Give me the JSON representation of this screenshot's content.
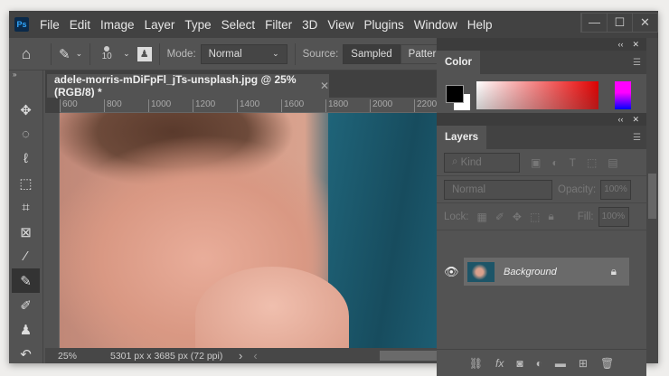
{
  "app": {
    "logo": "Ps",
    "menu": [
      "File",
      "Edit",
      "Image",
      "Layer",
      "Type",
      "Select",
      "Filter",
      "3D",
      "View",
      "Plugins",
      "Window",
      "Help"
    ],
    "window_buttons": [
      "—",
      "☐",
      "✕"
    ]
  },
  "options": {
    "brush_size": "10",
    "mode_label": "Mode:",
    "mode_value": "Normal",
    "source_label": "Source:",
    "source_sampled": "Sampled",
    "source_pattern": "Pattern"
  },
  "document": {
    "tab_title": "adele-morris-mDiFpFl_jTs-unsplash.jpg @ 25% (RGB/8) *",
    "ruler_ticks": [
      "600",
      "800",
      "1000",
      "1200",
      "1400",
      "1600",
      "1800",
      "2000",
      "2200"
    ],
    "zoom": "25%",
    "info": "5301 px x 3685 px (72 ppi)"
  },
  "color_panel": {
    "title": "Color"
  },
  "layers_panel": {
    "title": "Layers",
    "filter": "Kind",
    "blend": "Normal",
    "opacity_label": "Opacity:",
    "opacity": "100%",
    "lock_label": "Lock:",
    "fill_label": "Fill:",
    "fill": "100%",
    "layers": [
      {
        "name": "Background",
        "visible": true,
        "locked": true
      }
    ]
  },
  "colors": {
    "accent": "#31a8ff",
    "fg": "#000000",
    "bg": "#ffffff"
  }
}
